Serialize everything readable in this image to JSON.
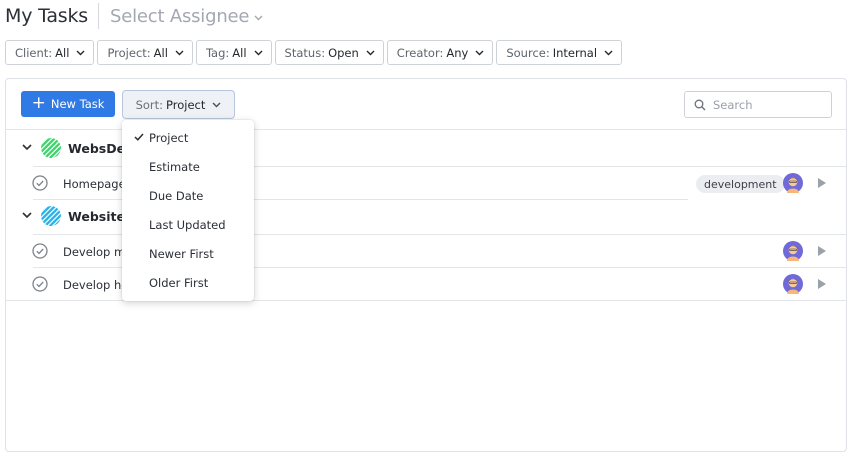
{
  "header": {
    "title": "My Tasks",
    "assignee_label": "Select Assignee"
  },
  "filters": [
    {
      "label": "Client:",
      "value": "All"
    },
    {
      "label": "Project:",
      "value": "All"
    },
    {
      "label": "Tag:",
      "value": "All"
    },
    {
      "label": "Status:",
      "value": "Open"
    },
    {
      "label": "Creator:",
      "value": "Any"
    },
    {
      "label": "Source:",
      "value": "Internal"
    }
  ],
  "toolbar": {
    "new_task_label": "New Task",
    "sort_label": "Sort:",
    "sort_value": "Project",
    "search_placeholder": "Search"
  },
  "groups": [
    {
      "name": "WebsDes",
      "icon_color": "#3dd26a"
    },
    {
      "name": "Website d",
      "icon_color": "#2ab0e8"
    }
  ],
  "tasks": [
    {
      "name": "Homepage c",
      "tag": "development"
    },
    {
      "name": "Develop ma",
      "tag": ""
    },
    {
      "name": "Develop hor",
      "tag": ""
    }
  ],
  "sort_menu": {
    "items": [
      "Project",
      "Estimate",
      "Due Date",
      "Last Updated",
      "Newer First",
      "Older First"
    ],
    "selected": "Project"
  },
  "colors": {
    "accent": "#2f7ae5",
    "avatar_bg": "#6f6ad8"
  }
}
